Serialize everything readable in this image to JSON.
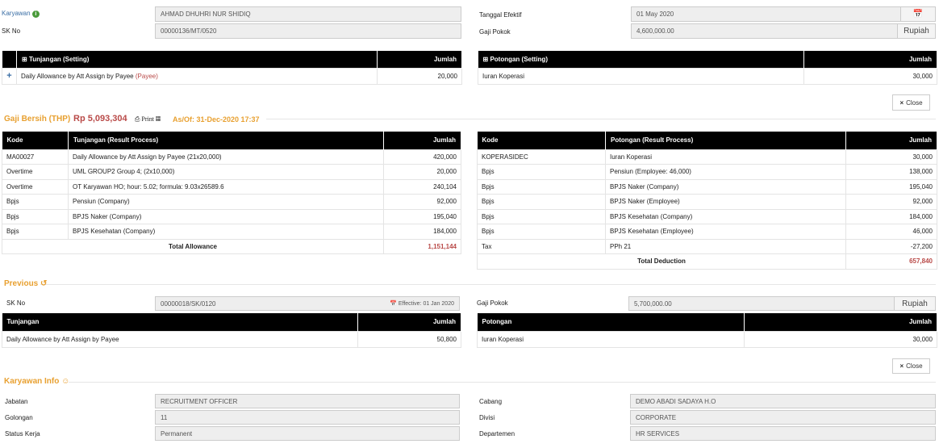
{
  "header": {
    "karyawan_label": "Karyawan",
    "karyawan_value": "AHMAD DHUHRI NUR SHIDIQ",
    "sk_label": "SK No",
    "sk_value": "00000136/MT/0520",
    "tanggal_label": "Tanggal Efektif",
    "tanggal_value": "01 May 2020",
    "gaji_label": "Gaji Pokok",
    "gaji_value": "4,600,000.00",
    "currency": "Rupiah"
  },
  "setting": {
    "tunj_header": "Tunjangan (Setting)",
    "jumlah": "Jumlah",
    "tunj_item": "Daily Allowance by Att Assign by Payee",
    "tunj_payee": "(Payee)",
    "tunj_value": "20,000",
    "pot_header": "Potongan (Setting)",
    "pot_item": "Iuran Koperasi",
    "pot_value": "30,000",
    "close": "Close"
  },
  "thp": {
    "label": "Gaji Bersih (THP)",
    "amount": "Rp 5,093,304",
    "print": "Print",
    "asof": "As/Of: 31-Dec-2020 17:37"
  },
  "result": {
    "kode": "Kode",
    "jumlah": "Jumlah",
    "tunj_header": "Tunjangan (Result Process)",
    "pot_header": "Potongan (Result Process)",
    "tunj_rows": [
      [
        "MA00027",
        "Daily Allowance by Att Assign by Payee (21x20,000)",
        "420,000"
      ],
      [
        "Overtime",
        "UML GROUP2 Group 4; (2x10,000)",
        "20,000"
      ],
      [
        "Overtime",
        "OT Karyawan HO; hour: 5.02; formula: 9.03x26589.6",
        "240,104"
      ],
      [
        "Bpjs",
        "Pensiun (Company)",
        "92,000"
      ],
      [
        "Bpjs",
        "BPJS Naker (Company)",
        "195,040"
      ],
      [
        "Bpjs",
        "BPJS Kesehatan (Company)",
        "184,000"
      ]
    ],
    "total_allowance_label": "Total Allowance",
    "total_allowance": "1,151,144",
    "pot_rows": [
      [
        "KOPERASIDEC",
        "Iuran Koperasi",
        "30,000"
      ],
      [
        "Bpjs",
        "Pensiun (Employee: 46,000)",
        "138,000"
      ],
      [
        "Bpjs",
        "BPJS Naker (Company)",
        "195,040"
      ],
      [
        "Bpjs",
        "BPJS Naker (Employee)",
        "92,000"
      ],
      [
        "Bpjs",
        "BPJS Kesehatan (Company)",
        "184,000"
      ],
      [
        "Bpjs",
        "BPJS Kesehatan (Employee)",
        "46,000"
      ],
      [
        "Tax",
        "PPh 21",
        "-27,200"
      ]
    ],
    "total_deduction_label": "Total Deduction",
    "total_deduction": "657,840"
  },
  "previous": {
    "title": "Previous",
    "sk_label": "SK No",
    "sk_value": "00000018/SK/0120",
    "effective": "Effective: 01 Jan 2020",
    "gaji_label": "Gaji Pokok",
    "gaji_value": "5,700,000.00",
    "currency": "Rupiah",
    "tunj_header": "Tunjangan",
    "pot_header": "Potongan",
    "jumlah": "Jumlah",
    "tunj_item": "Daily Allowance by Att Assign by Payee",
    "tunj_value": "50,800",
    "pot_item": "Iuran Koperasi",
    "pot_value": "30,000",
    "close": "Close"
  },
  "info": {
    "title": "Karyawan Info",
    "jabatan_label": "Jabatan",
    "jabatan": "RECRUITMENT OFFICER",
    "golongan_label": "Golongan",
    "golongan": "11",
    "status_label": "Status Kerja",
    "status": "Permanent",
    "cabang_label": "Cabang",
    "cabang": "DEMO ABADI SADAYA H.O",
    "divisi_label": "Divisi",
    "divisi": "CORPORATE",
    "departemen_label": "Departemen",
    "departemen": "HR SERVICES"
  },
  "colors": {
    "accent": "#e8a030",
    "link": "#3a6ea5",
    "danger": "#b94a48",
    "header_bg": "#000000"
  }
}
